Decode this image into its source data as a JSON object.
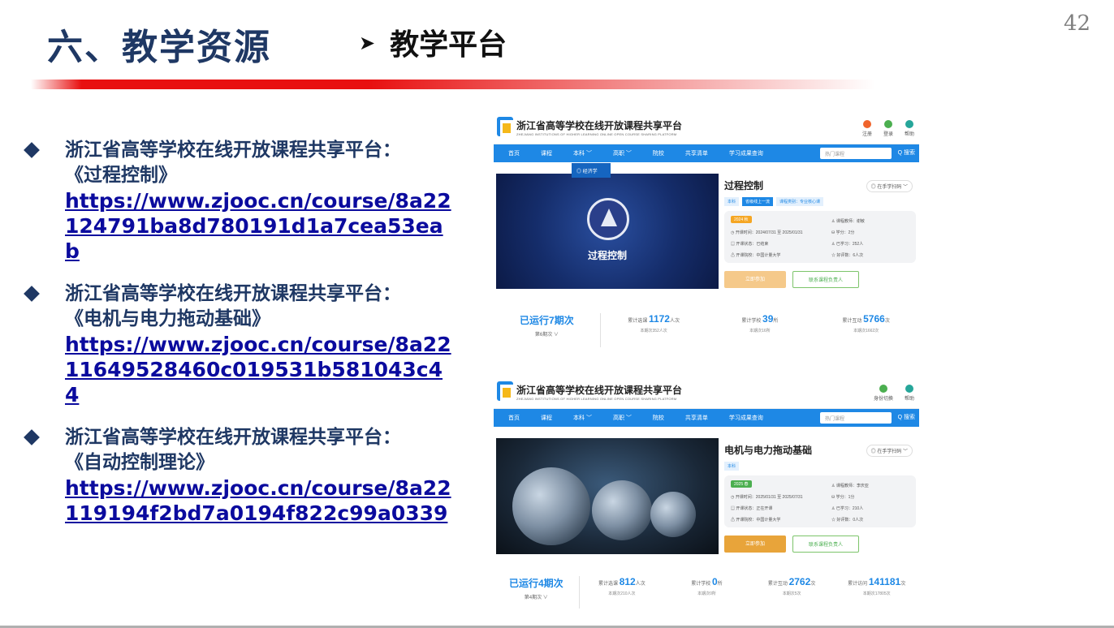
{
  "slide": {
    "title": "六、教学资源",
    "subtitle": "教学平台",
    "page_number": "42"
  },
  "bullets": [
    {
      "platform": "浙江省高等学校在线开放课程共享平台：",
      "course": "《过程控制》",
      "url": "https://www.zjooc.cn/course/8a22124791ba8d780191d1a7cea53eab"
    },
    {
      "platform": "浙江省高等学校在线开放课程共享平台：",
      "course": "《电机与电力拖动基础》",
      "url": "https://www.zjooc.cn/course/8a2211649528460c019531b581043c44"
    },
    {
      "platform": "浙江省高等学校在线开放课程共享平台：",
      "course": "《自动控制理论》",
      "url": "https://www.zjooc.cn/course/8a22119194f2bd7a0194f822c99a0339"
    }
  ],
  "screens": [
    {
      "site_name": "浙江省高等学校在线开放课程共享平台",
      "site_name_en": "ZHEJIANG INSTITUTIONS OF HIGHER LEARNING ONLINE OPEN COURSE SHARING PLATFORM",
      "header_icons": [
        {
          "label": "注册",
          "color": "#f0642c"
        },
        {
          "label": "登录",
          "color": "#4caf50"
        },
        {
          "label": "帮助",
          "color": "#26a69a"
        }
      ],
      "nav": [
        "首页",
        "课程",
        "本科 ﹀",
        "高职 ﹀",
        "院校",
        "共享清单",
        "学习成果查询"
      ],
      "search_placeholder": "热门课程",
      "search_button": "Q 搜索",
      "dropdown_item": "◎ 经济学",
      "banner_text": "过程控制",
      "course_title": "过程控制",
      "scan_label": "◎ 在手学扫码 ﹀",
      "tags": [
        "本科",
        "省级线上一流",
        "课程类别：专业核心课"
      ],
      "term_badge": "2024 秋",
      "left_info": [
        "◷ 开课时间：2024/07/31 至 2025/01/31",
        "▤ 开课状态：已结束",
        "⚠ 开课院校：中国计量大学"
      ],
      "right_info": [
        "♙ 课程教师：谢敏",
        "⛁ 学分：2分",
        "♙ 已学习：252人",
        "☆ 好评数：6人次"
      ],
      "join_button": "立即参加",
      "contact_button": "联系课程负责人",
      "runs": "已运行7期次",
      "runs_sub": "第6期次 ∨",
      "stats": [
        {
          "label": "累计选课",
          "value": "1172",
          "unit": "人次",
          "sub": "本期次352人次"
        },
        {
          "label": "累计学校",
          "value": "39",
          "unit": "所",
          "sub": "本期次16所"
        },
        {
          "label": "累计互动",
          "value": "5766",
          "unit": "次",
          "sub": "本期次1662次"
        }
      ]
    },
    {
      "site_name": "浙江省高等学校在线开放课程共享平台",
      "site_name_en": "ZHEJIANG INSTITUTIONS OF HIGHER LEARNING ONLINE OPEN COURSE SHARING PLATFORM",
      "header_icons": [
        {
          "label": "身份切换",
          "color": "#4caf50"
        },
        {
          "label": "帮助",
          "color": "#26a69a"
        }
      ],
      "nav": [
        "首页",
        "课程",
        "本科 ﹀",
        "高职 ﹀",
        "院校",
        "共享清单",
        "学习成果查询"
      ],
      "search_placeholder": "热门课程",
      "search_button": "Q 搜索",
      "course_title": "电机与电力拖动基础",
      "scan_label": "◎ 在手学扫码 ﹀",
      "tags": [
        "本科"
      ],
      "term_badge": "2025 春",
      "left_info": [
        "◷ 开课时间：2025/01/31 至 2025/07/31",
        "▤ 开课状态：正在开课",
        "⚠ 开课院校：中国计量大学"
      ],
      "right_info": [
        "♙ 课程教师：李庆亚",
        "⛁ 学分：1分",
        "♙ 已学习：210人",
        "☆ 好评数：0人次"
      ],
      "join_button": "立即参加",
      "contact_button": "联系课程负责人",
      "runs": "已运行4期次",
      "runs_sub": "第4期次 ∨",
      "stats": [
        {
          "label": "累计选课",
          "value": "812",
          "unit": "人次",
          "sub": "本期次210人次"
        },
        {
          "label": "累计学校",
          "value": "0",
          "unit": "所",
          "sub": "本期次0所"
        },
        {
          "label": "累计互动",
          "value": "2762",
          "unit": "次",
          "sub": "本期次5次"
        },
        {
          "label": "累计访问",
          "value": "141181",
          "unit": "次",
          "sub": "本期次17805次"
        }
      ]
    }
  ]
}
